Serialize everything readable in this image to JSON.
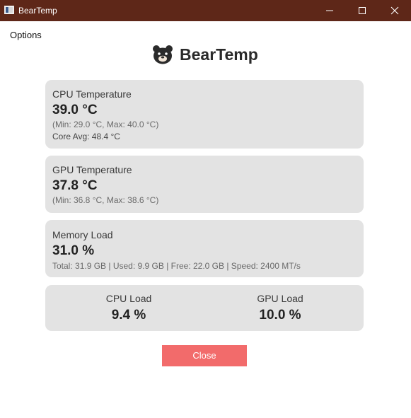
{
  "window": {
    "title": "BearTemp"
  },
  "menu": {
    "options_label": "Options"
  },
  "header": {
    "app_name": "BearTemp"
  },
  "cpu_temp": {
    "label": "CPU Temperature",
    "value": "39.0 °C",
    "range": "(Min: 29.0 °C, Max: 40.0 °C)",
    "core_avg": "Core Avg: 48.4 °C"
  },
  "gpu_temp": {
    "label": "GPU Temperature",
    "value": "37.8 °C",
    "range": "(Min: 36.8 °C, Max: 38.6 °C)"
  },
  "memory": {
    "label": "Memory Load",
    "value": "31.0 %",
    "details": "Total: 31.9 GB | Used: 9.9 GB | Free: 22.0 GB | Speed: 2400 MT/s"
  },
  "loads": {
    "cpu_label": "CPU Load",
    "cpu_value": "9.4 %",
    "gpu_label": "GPU Load",
    "gpu_value": "10.0 %"
  },
  "actions": {
    "close_label": "Close"
  },
  "colors": {
    "titlebar": "#5e2718",
    "card_bg": "#e3e3e3",
    "close_button": "#f26b6b"
  },
  "icons": {
    "app": "app-window-icon",
    "header": "bear-icon",
    "minimize": "minimize-icon",
    "maximize": "maximize-icon",
    "close": "close-icon"
  }
}
